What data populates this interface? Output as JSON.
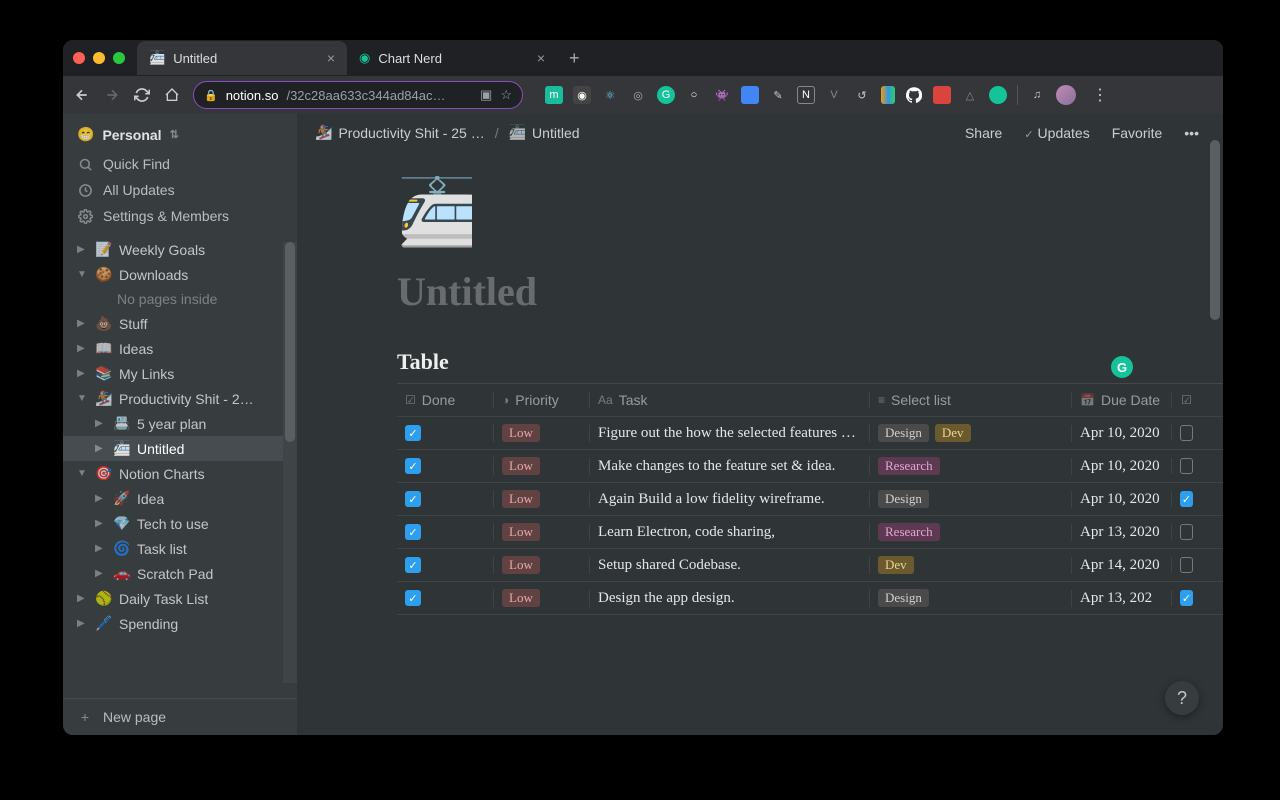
{
  "browser": {
    "tabs": [
      {
        "favicon": "🚈",
        "title": "Untitled",
        "active": true
      },
      {
        "favicon": "🟢",
        "title": "Chart Nerd",
        "active": false
      }
    ],
    "url_domain": "notion.so",
    "url_path": "/32c28aa633c344ad84ac…"
  },
  "sidebar": {
    "workspace_emoji": "😁",
    "workspace_name": "Personal",
    "quick_find": "Quick Find",
    "all_updates": "All Updates",
    "settings": "Settings & Members",
    "new_page": "New page",
    "empty_label": "No pages inside",
    "tree": [
      {
        "caret": "▶",
        "emoji": "📝",
        "label": "Weekly Goals",
        "depth": 0
      },
      {
        "caret": "▼",
        "emoji": "🍪",
        "label": "Downloads",
        "depth": 0
      },
      {
        "empty": true,
        "depth": 1
      },
      {
        "caret": "▶",
        "emoji": "💩",
        "label": "Stuff",
        "depth": 0
      },
      {
        "caret": "▶",
        "emoji": "📖",
        "label": "Ideas",
        "depth": 0
      },
      {
        "caret": "▶",
        "emoji": "📚",
        "label": "My Links",
        "depth": 0
      },
      {
        "caret": "▼",
        "emoji": "🏂",
        "label": "Productivity Shit - 2…",
        "depth": 0
      },
      {
        "caret": "▶",
        "emoji": "📇",
        "label": "5 year plan",
        "depth": 1
      },
      {
        "caret": "▶",
        "emoji": "🚈",
        "label": "Untitled",
        "depth": 1,
        "selected": true
      },
      {
        "caret": "▼",
        "emoji": "🎯",
        "label": "Notion Charts",
        "depth": 0
      },
      {
        "caret": "▶",
        "emoji": "🚀",
        "label": "Idea",
        "depth": 1
      },
      {
        "caret": "▶",
        "emoji": "💎",
        "label": "Tech to use",
        "depth": 1
      },
      {
        "caret": "▶",
        "emoji": "🌀",
        "label": "Task list",
        "depth": 1
      },
      {
        "caret": "▶",
        "emoji": "🚗",
        "label": "Scratch Pad",
        "depth": 1
      },
      {
        "caret": "▶",
        "emoji": "🥎",
        "label": "Daily Task List",
        "depth": 0
      },
      {
        "caret": "▶",
        "emoji": "🖊️",
        "label": "Spending",
        "depth": 0
      }
    ]
  },
  "topbar": {
    "crumb1_emoji": "🏂",
    "crumb1_label": "Productivity Shit - 25 …",
    "crumb2_emoji": "🚈",
    "crumb2_label": "Untitled",
    "share": "Share",
    "updates": "Updates",
    "favorite": "Favorite"
  },
  "page": {
    "icon": "🚈",
    "title_placeholder": "Untitled",
    "block_title": "Table"
  },
  "table": {
    "columns": {
      "done": "Done",
      "priority": "Priority",
      "task": "Task",
      "select": "Select list",
      "due": "Due Date"
    },
    "rows": [
      {
        "done": true,
        "priority": "Low",
        "task": "Figure out the how the selected features will w",
        "tags": [
          "Design",
          "Dev"
        ],
        "due": "Apr 10, 2020",
        "chk2": false
      },
      {
        "done": true,
        "priority": "Low",
        "task": "Make changes to the feature set & idea.",
        "tags": [
          "Research"
        ],
        "due": "Apr 10, 2020",
        "chk2": false
      },
      {
        "done": true,
        "priority": "Low",
        "task": "Again Build a low fidelity wireframe.",
        "tags": [
          "Design"
        ],
        "due": "Apr 10, 2020",
        "chk2": true
      },
      {
        "done": true,
        "priority": "Low",
        "task": "Learn Electron, code sharing,",
        "tags": [
          "Research"
        ],
        "due": "Apr 13, 2020",
        "chk2": false
      },
      {
        "done": true,
        "priority": "Low",
        "task": "Setup shared Codebase.",
        "tags": [
          "Dev"
        ],
        "due": "Apr 14, 2020",
        "chk2": false
      },
      {
        "done": true,
        "priority": "Low",
        "task": "Design the app design.",
        "tags": [
          "Design"
        ],
        "due": "Apr 13, 202",
        "chk2": true
      }
    ]
  },
  "help": "?"
}
